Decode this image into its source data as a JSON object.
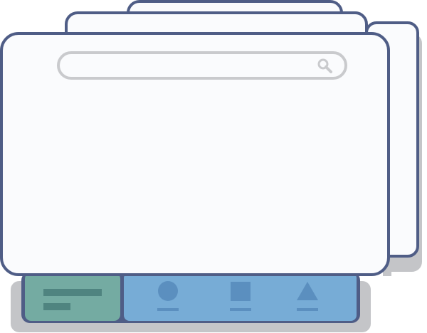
{
  "colors": {
    "outline": "#4f5d86",
    "window_fill": "#fafbfd",
    "shadow": "#c4c5c8",
    "search_stroke": "#c9cacd",
    "green_panel": "#74aba2",
    "green_bar": "#4f8480",
    "blue_panel": "#77acd6",
    "blue_icon": "#5b8fbf"
  },
  "icons": {
    "search": "search-icon",
    "circle": "circle-icon",
    "square": "square-icon",
    "triangle": "triangle-icon"
  },
  "search": {
    "value": "",
    "placeholder": ""
  }
}
